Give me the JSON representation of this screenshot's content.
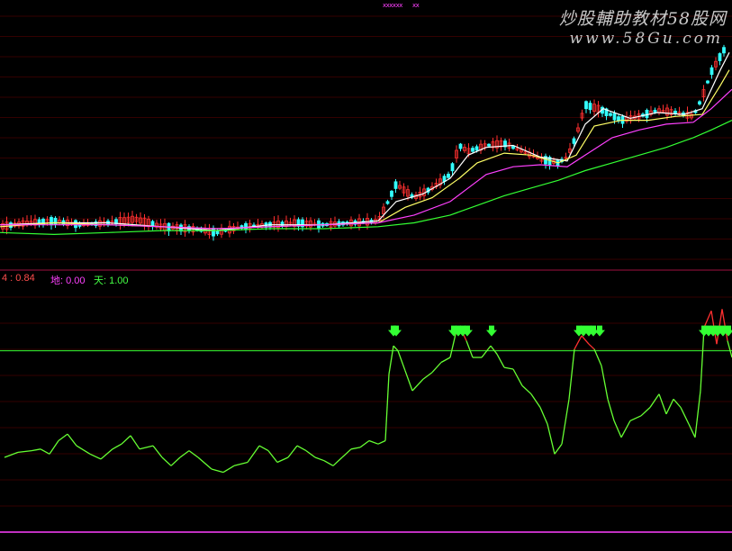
{
  "watermark": {
    "line1": "炒股輔助教材58股网",
    "line2": "www.58Gu.com"
  },
  "top_tags": {
    "tag1": "xxxxxx",
    "tag2": "xx"
  },
  "indicator": {
    "label1": "4 : 0.84",
    "label2": "地: 0.00",
    "label3": "天: 1.00",
    "colors": {
      "label1": "#ff4d4d",
      "label2": "#ff40ff",
      "label3": "#44ff44"
    }
  },
  "colors": {
    "up": "#ff3030",
    "down": "#33ffff",
    "ma5": "#ffffff",
    "ma10": "#ffff66",
    "ma20": "#ff40ff",
    "ma60": "#33ff33",
    "osc": "#66ff33",
    "osc_high": "#ff3030",
    "arrow": "#33ff33",
    "separator": "#a01040",
    "level_line": "#33ff33",
    "bottom_line": "#ff40ff",
    "grid": "#330000"
  },
  "chart_data": [
    {
      "type": "candlestick",
      "title": "",
      "series": [
        {
          "name": "",
          "role": "price",
          "points": [
            [
              0,
              10.3
            ],
            [
              30,
              10.5
            ],
            [
              60,
              10.6
            ],
            [
              90,
              10.4
            ],
            [
              120,
              10.5
            ],
            [
              150,
              10.7
            ],
            [
              180,
              10.3
            ],
            [
              210,
              10.2
            ],
            [
              240,
              10.0
            ],
            [
              270,
              10.3
            ],
            [
              300,
              10.4
            ],
            [
              330,
              10.5
            ],
            [
              360,
              10.4
            ],
            [
              390,
              10.5
            ],
            [
              420,
              10.6
            ],
            [
              430,
              11.5
            ],
            [
              440,
              12.5
            ],
            [
              460,
              11.8
            ],
            [
              480,
              12.3
            ],
            [
              500,
              13.0
            ],
            [
              510,
              14.5
            ],
            [
              520,
              14.2
            ],
            [
              540,
              14.5
            ],
            [
              560,
              14.6
            ],
            [
              580,
              14.2
            ],
            [
              600,
              13.8
            ],
            [
              620,
              13.6
            ],
            [
              630,
              13.9
            ],
            [
              640,
              15.0
            ],
            [
              650,
              16.6
            ],
            [
              670,
              16.3
            ],
            [
              690,
              15.8
            ],
            [
              710,
              16.0
            ],
            [
              730,
              16.3
            ],
            [
              750,
              16.2
            ],
            [
              770,
              16.0
            ],
            [
              780,
              17.0
            ],
            [
              790,
              18.3
            ],
            [
              805,
              19.5
            ]
          ]
        },
        {
          "name": "",
          "role": "ma5",
          "points": [
            [
              0,
              10.4
            ],
            [
              60,
              10.5
            ],
            [
              120,
              10.5
            ],
            [
              180,
              10.3
            ],
            [
              240,
              10.1
            ],
            [
              300,
              10.4
            ],
            [
              360,
              10.4
            ],
            [
              420,
              10.6
            ],
            [
              440,
              11.6
            ],
            [
              470,
              12.0
            ],
            [
              500,
              12.8
            ],
            [
              520,
              14.0
            ],
            [
              540,
              14.4
            ],
            [
              570,
              14.5
            ],
            [
              600,
              13.9
            ],
            [
              630,
              13.7
            ],
            [
              650,
              15.6
            ],
            [
              670,
              16.4
            ],
            [
              700,
              15.9
            ],
            [
              730,
              16.2
            ],
            [
              760,
              16.1
            ],
            [
              780,
              16.4
            ],
            [
              800,
              18.4
            ],
            [
              810,
              19.3
            ]
          ]
        },
        {
          "name": "",
          "role": "ma10",
          "points": [
            [
              0,
              10.3
            ],
            [
              60,
              10.5
            ],
            [
              120,
              10.4
            ],
            [
              180,
              10.3
            ],
            [
              240,
              10.2
            ],
            [
              300,
              10.3
            ],
            [
              360,
              10.4
            ],
            [
              420,
              10.5
            ],
            [
              450,
              11.3
            ],
            [
              480,
              11.8
            ],
            [
              510,
              12.8
            ],
            [
              530,
              13.6
            ],
            [
              560,
              14.1
            ],
            [
              590,
              14.0
            ],
            [
              620,
              13.6
            ],
            [
              640,
              14.0
            ],
            [
              660,
              15.5
            ],
            [
              690,
              15.8
            ],
            [
              720,
              15.8
            ],
            [
              750,
              16.0
            ],
            [
              780,
              16.1
            ],
            [
              800,
              17.6
            ],
            [
              810,
              18.4
            ]
          ]
        },
        {
          "name": "",
          "role": "ma20",
          "points": [
            [
              0,
              10.4
            ],
            [
              60,
              10.4
            ],
            [
              120,
              10.4
            ],
            [
              180,
              10.3
            ],
            [
              240,
              10.2
            ],
            [
              300,
              10.3
            ],
            [
              360,
              10.4
            ],
            [
              420,
              10.5
            ],
            [
              460,
              10.9
            ],
            [
              500,
              11.6
            ],
            [
              520,
              12.3
            ],
            [
              540,
              13.0
            ],
            [
              570,
              13.4
            ],
            [
              600,
              13.5
            ],
            [
              630,
              13.4
            ],
            [
              650,
              14.0
            ],
            [
              680,
              14.9
            ],
            [
              710,
              15.3
            ],
            [
              740,
              15.6
            ],
            [
              770,
              15.7
            ],
            [
              790,
              16.4
            ],
            [
              813,
              17.4
            ]
          ]
        },
        {
          "name": "",
          "role": "ma60",
          "points": [
            [
              0,
              10.0
            ],
            [
              60,
              9.9
            ],
            [
              120,
              10.0
            ],
            [
              180,
              10.1
            ],
            [
              240,
              10.1
            ],
            [
              300,
              10.2
            ],
            [
              360,
              10.2
            ],
            [
              420,
              10.3
            ],
            [
              460,
              10.5
            ],
            [
              500,
              10.9
            ],
            [
              530,
              11.4
            ],
            [
              560,
              11.9
            ],
            [
              590,
              12.3
            ],
            [
              620,
              12.7
            ],
            [
              650,
              13.2
            ],
            [
              680,
              13.6
            ],
            [
              710,
              14.0
            ],
            [
              740,
              14.4
            ],
            [
              770,
              14.9
            ],
            [
              790,
              15.3
            ],
            [
              813,
              15.8
            ]
          ]
        }
      ]
    },
    {
      "type": "line",
      "title": "",
      "level_line": 0.84,
      "series": [
        {
          "name": "",
          "role": "oscillator",
          "points": [
            [
              5,
              0.2
            ],
            [
              20,
              0.23
            ],
            [
              35,
              0.24
            ],
            [
              45,
              0.25
            ],
            [
              55,
              0.22
            ],
            [
              65,
              0.3
            ],
            [
              75,
              0.34
            ],
            [
              85,
              0.27
            ],
            [
              100,
              0.22
            ],
            [
              112,
              0.19
            ],
            [
              125,
              0.25
            ],
            [
              135,
              0.28
            ],
            [
              145,
              0.33
            ],
            [
              155,
              0.25
            ],
            [
              170,
              0.27
            ],
            [
              180,
              0.2
            ],
            [
              190,
              0.15
            ],
            [
              200,
              0.2
            ],
            [
              210,
              0.24
            ],
            [
              220,
              0.2
            ],
            [
              235,
              0.13
            ],
            [
              248,
              0.11
            ],
            [
              260,
              0.15
            ],
            [
              275,
              0.17
            ],
            [
              288,
              0.27
            ],
            [
              298,
              0.24
            ],
            [
              308,
              0.17
            ],
            [
              320,
              0.2
            ],
            [
              330,
              0.27
            ],
            [
              340,
              0.24
            ],
            [
              350,
              0.2
            ],
            [
              360,
              0.18
            ],
            [
              370,
              0.15
            ],
            [
              380,
              0.2
            ],
            [
              390,
              0.25
            ],
            [
              400,
              0.26
            ],
            [
              410,
              0.3
            ],
            [
              420,
              0.28
            ],
            [
              428,
              0.3
            ],
            [
              432,
              0.7
            ],
            [
              437,
              0.87
            ],
            [
              442,
              0.84
            ],
            [
              450,
              0.72
            ],
            [
              458,
              0.6
            ],
            [
              470,
              0.67
            ],
            [
              480,
              0.71
            ],
            [
              490,
              0.77
            ],
            [
              500,
              0.8
            ],
            [
              506,
              0.94
            ],
            [
              512,
              0.97
            ],
            [
              518,
              0.9
            ],
            [
              525,
              0.8
            ],
            [
              535,
              0.8
            ],
            [
              545,
              0.87
            ],
            [
              552,
              0.82
            ],
            [
              560,
              0.74
            ],
            [
              570,
              0.73
            ],
            [
              580,
              0.63
            ],
            [
              590,
              0.58
            ],
            [
              600,
              0.5
            ],
            [
              608,
              0.4
            ],
            [
              616,
              0.22
            ],
            [
              624,
              0.28
            ],
            [
              632,
              0.55
            ],
            [
              638,
              0.85
            ],
            [
              646,
              0.93
            ],
            [
              654,
              0.88
            ],
            [
              660,
              0.85
            ],
            [
              668,
              0.75
            ],
            [
              675,
              0.55
            ],
            [
              682,
              0.42
            ],
            [
              690,
              0.32
            ],
            [
              700,
              0.42
            ],
            [
              712,
              0.45
            ],
            [
              722,
              0.5
            ],
            [
              732,
              0.58
            ],
            [
              740,
              0.46
            ],
            [
              748,
              0.55
            ],
            [
              756,
              0.5
            ],
            [
              765,
              0.4
            ],
            [
              772,
              0.32
            ],
            [
              778,
              0.6
            ],
            [
              782,
              0.98
            ],
            [
              790,
              1.08
            ],
            [
              796,
              0.88
            ],
            [
              802,
              1.09
            ],
            [
              808,
              0.9
            ],
            [
              813,
              0.8
            ]
          ]
        }
      ],
      "signals_x": [
        437,
        440,
        504,
        509,
        514,
        519,
        546,
        643,
        648,
        654,
        659,
        666,
        782,
        787,
        792,
        797,
        803,
        809
      ]
    }
  ]
}
